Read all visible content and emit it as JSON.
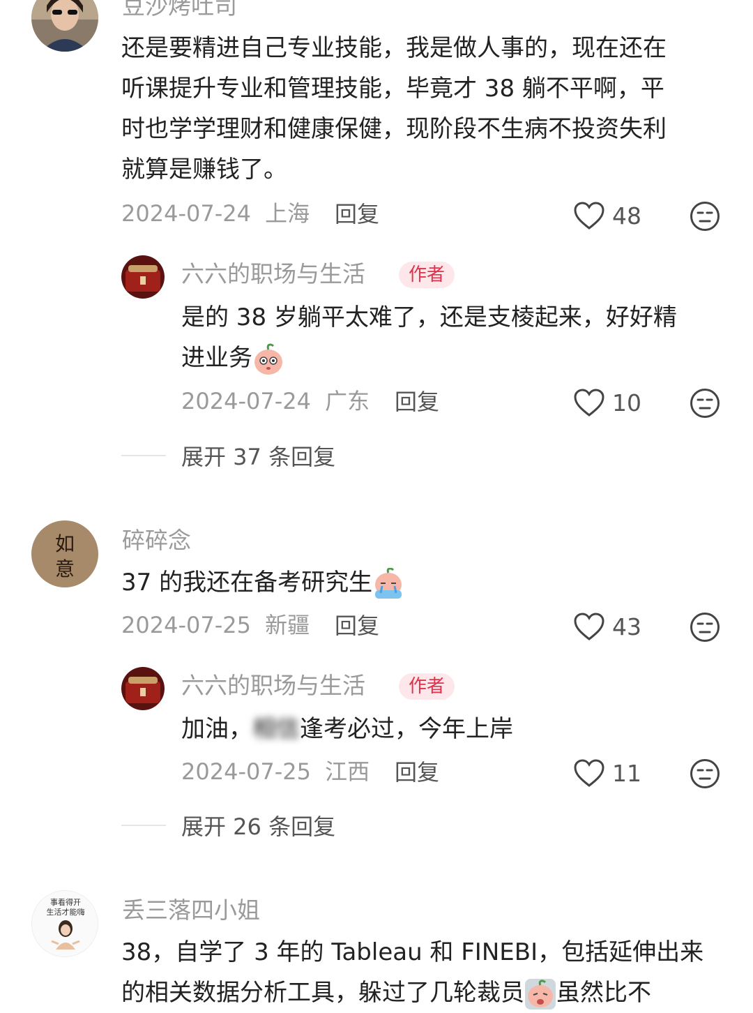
{
  "comments": [
    {
      "user": "豆沙烤吐司",
      "text_lines": [
        "还是要精进自己专业技能，我是做人事的，现在还在",
        "听课提升专业和管理技能，毕竟才 38 躺不平啊，平",
        "时也学学理财和健康保健，现阶段不生病不投资失利",
        "就算是赚钱了。"
      ],
      "date": "2024-07-24",
      "location": "上海",
      "reply_label": "回复",
      "likes": "48",
      "reply": {
        "user": "六六的职场与生活",
        "badge": "作者",
        "text_line1": "是的 38 岁躺平太难了，还是支棱起来，好好精",
        "text_line2": "进业务",
        "date": "2024-07-24",
        "location": "广东",
        "reply_label": "回复",
        "likes": "10"
      },
      "expand_label": "展开 37 条回复"
    },
    {
      "user": "碎碎念",
      "avatar_text": [
        "如",
        "意"
      ],
      "text": "37 的我还在备考研究生",
      "date": "2024-07-25",
      "location": "新疆",
      "reply_label": "回复",
      "likes": "43",
      "reply": {
        "user": "六六的职场与生活",
        "badge": "作者",
        "text_start": "加油，",
        "text_blurred": "相信",
        "text_partial": "逢",
        "text_end": "考必过，今年上岸",
        "date": "2024-07-25",
        "location": "江西",
        "reply_label": "回复",
        "likes": "11"
      },
      "expand_label": "展开 26 条回复"
    },
    {
      "user": "丢三落四小姐",
      "avatar_text": [
        "事看得开",
        "生活才能嗨"
      ],
      "text_line1": "38，自学了 3 年的 Tableau 和 FINEBI，包括延伸出来",
      "text_line2a": "的相关数据分析工具，躲过了几轮裁员",
      "text_line2b": "虽然比不"
    }
  ],
  "colors": {
    "badge_bg": "#fde7ea",
    "badge_text": "#e0334b",
    "meta": "#9a9a9a"
  },
  "icons": [
    "heart-icon",
    "meh-face-icon"
  ]
}
